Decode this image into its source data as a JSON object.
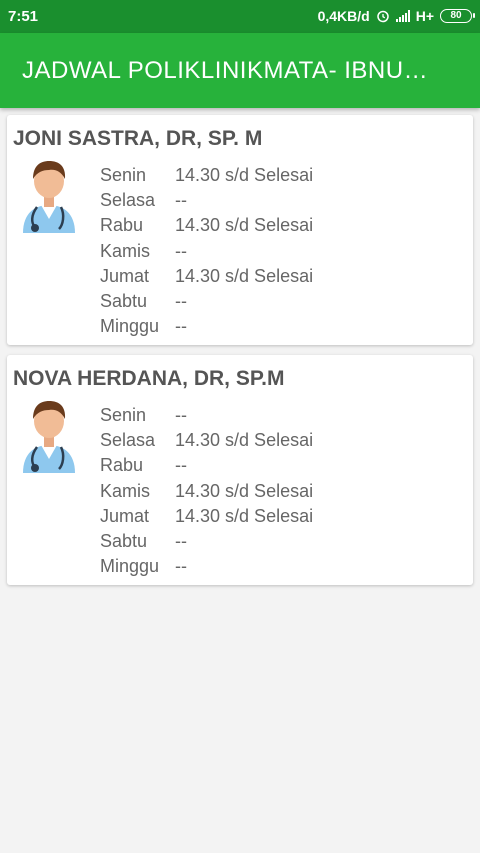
{
  "status_bar": {
    "time": "7:51",
    "network_speed": "0,4KB/d",
    "network_type": "H+",
    "battery": "80",
    "icons": [
      "alarm-icon",
      "signal-icon",
      "battery-icon"
    ]
  },
  "app_bar": {
    "title": "JADWAL POLIKLINIKMATA- IBNU…",
    "color": "#27b23b"
  },
  "doctors": [
    {
      "name": "JONI SASTRA, DR, SP. M",
      "icon": "doctor-avatar-icon",
      "schedule": [
        {
          "day": "Senin",
          "time": "14.30 s/d Selesai"
        },
        {
          "day": "Selasa",
          "time": "--"
        },
        {
          "day": "Rabu",
          "time": "14.30 s/d Selesai"
        },
        {
          "day": "Kamis",
          "time": "--"
        },
        {
          "day": "Jumat",
          "time": "14.30 s/d Selesai"
        },
        {
          "day": "Sabtu",
          "time": "--"
        },
        {
          "day": "Minggu",
          "time": "--"
        }
      ]
    },
    {
      "name": "NOVA HERDANA, DR, SP.M",
      "icon": "doctor-avatar-icon",
      "schedule": [
        {
          "day": "Senin",
          "time": "--"
        },
        {
          "day": "Selasa",
          "time": "14.30 s/d Selesai"
        },
        {
          "day": "Rabu",
          "time": "--"
        },
        {
          "day": "Kamis",
          "time": "14.30 s/d Selesai"
        },
        {
          "day": "Jumat",
          "time": "14.30 s/d Selesai"
        },
        {
          "day": "Sabtu",
          "time": "--"
        },
        {
          "day": "Minggu",
          "time": "--"
        }
      ]
    }
  ]
}
